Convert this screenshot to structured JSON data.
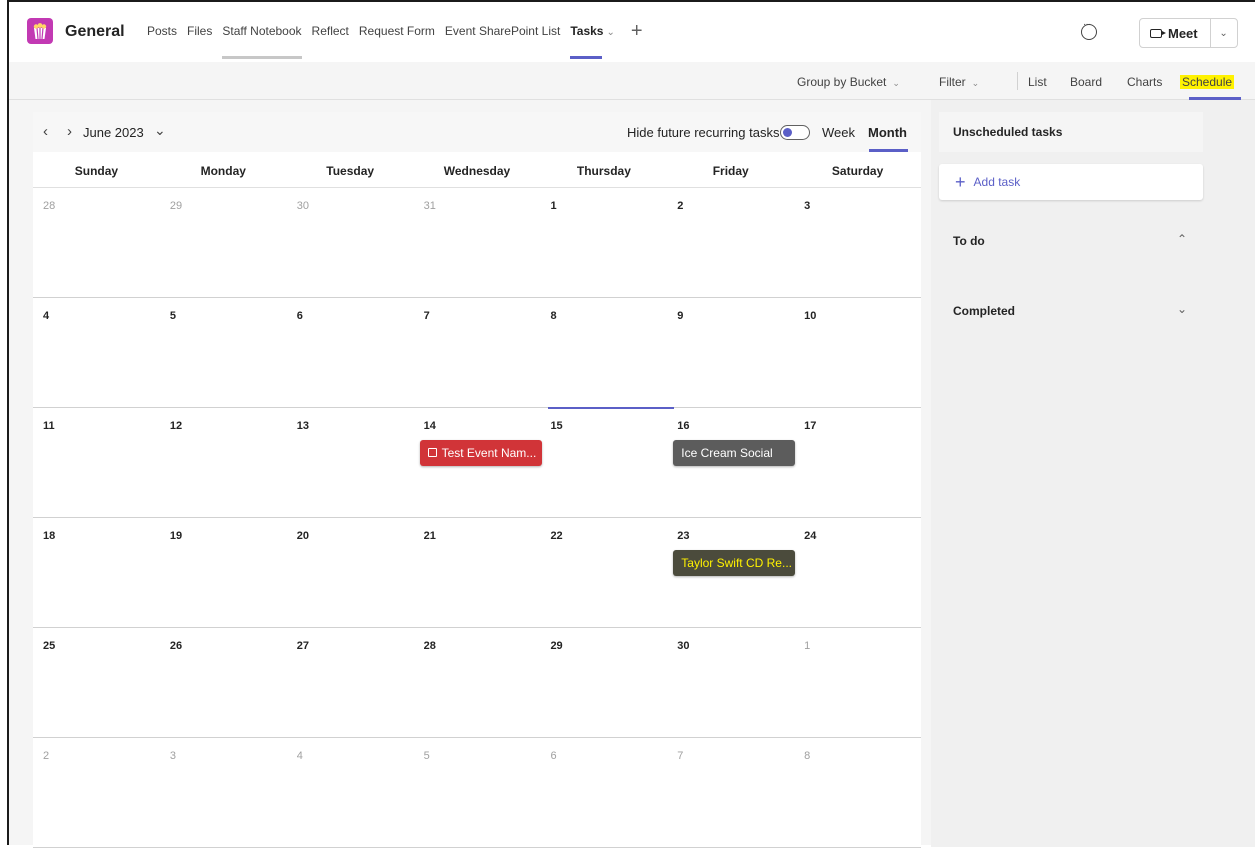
{
  "channel": {
    "name": "General"
  },
  "tabs": [
    {
      "label": "Posts"
    },
    {
      "label": "Files"
    },
    {
      "label": "Staff Notebook"
    },
    {
      "label": "Reflect"
    },
    {
      "label": "Request Form"
    },
    {
      "label": "Event SharePoint List"
    },
    {
      "label": "Tasks"
    }
  ],
  "header_actions": {
    "meet_label": "Meet"
  },
  "toolbar": {
    "group_by": "Group by Bucket",
    "filter": "Filter",
    "list": "List",
    "board": "Board",
    "charts": "Charts",
    "schedule": "Schedule"
  },
  "calendar": {
    "month_label": "June 2023",
    "hide_recurring_label": "Hide future recurring tasks",
    "hide_recurring_on": true,
    "view_week": "Week",
    "view_month": "Month",
    "active_view": "Month",
    "day_headers": [
      "Sunday",
      "Monday",
      "Tuesday",
      "Wednesday",
      "Thursday",
      "Friday",
      "Saturday"
    ],
    "weeks": [
      [
        {
          "day": "28",
          "in_month": false
        },
        {
          "day": "29",
          "in_month": false
        },
        {
          "day": "30",
          "in_month": false
        },
        {
          "day": "31",
          "in_month": false
        },
        {
          "day": "1",
          "in_month": true
        },
        {
          "day": "2",
          "in_month": true
        },
        {
          "day": "3",
          "in_month": true
        }
      ],
      [
        {
          "day": "4",
          "in_month": true
        },
        {
          "day": "5",
          "in_month": true
        },
        {
          "day": "6",
          "in_month": true
        },
        {
          "day": "7",
          "in_month": true
        },
        {
          "day": "8",
          "in_month": true
        },
        {
          "day": "9",
          "in_month": true
        },
        {
          "day": "10",
          "in_month": true
        }
      ],
      [
        {
          "day": "11",
          "in_month": true
        },
        {
          "day": "12",
          "in_month": true
        },
        {
          "day": "13",
          "in_month": true
        },
        {
          "day": "14",
          "in_month": true,
          "events": [
            {
              "title": "Test Event Nam...",
              "color": "#d13438",
              "icon": "calendar-icon"
            }
          ]
        },
        {
          "day": "15",
          "in_month": true,
          "today": true
        },
        {
          "day": "16",
          "in_month": true,
          "events": [
            {
              "title": "Ice Cream Social",
              "color": "#5c5c5c"
            }
          ]
        },
        {
          "day": "17",
          "in_month": true
        }
      ],
      [
        {
          "day": "18",
          "in_month": true
        },
        {
          "day": "19",
          "in_month": true
        },
        {
          "day": "20",
          "in_month": true
        },
        {
          "day": "21",
          "in_month": true
        },
        {
          "day": "22",
          "in_month": true
        },
        {
          "day": "23",
          "in_month": true,
          "events": [
            {
              "title": "Taylor Swift CD Re...",
              "color": "#5c5c5c",
              "highlighted": true
            }
          ]
        },
        {
          "day": "24",
          "in_month": true
        }
      ],
      [
        {
          "day": "25",
          "in_month": true
        },
        {
          "day": "26",
          "in_month": true
        },
        {
          "day": "27",
          "in_month": true
        },
        {
          "day": "28",
          "in_month": true
        },
        {
          "day": "29",
          "in_month": true
        },
        {
          "day": "30",
          "in_month": true
        },
        {
          "day": "1",
          "in_month": false
        }
      ],
      [
        {
          "day": "2",
          "in_month": false
        },
        {
          "day": "3",
          "in_month": false
        },
        {
          "day": "4",
          "in_month": false
        },
        {
          "day": "5",
          "in_month": false
        },
        {
          "day": "6",
          "in_month": false
        },
        {
          "day": "7",
          "in_month": false
        },
        {
          "day": "8",
          "in_month": false
        }
      ]
    ]
  },
  "side_panel": {
    "title": "Unscheduled tasks",
    "add_task": "Add task",
    "buckets": [
      {
        "label": "To do",
        "expanded": true
      },
      {
        "label": "Completed",
        "expanded": false
      }
    ]
  },
  "colors": {
    "accent": "#5b5fc7",
    "highlight": "#fff200",
    "event_red": "#d13438",
    "event_grey": "#5c5c5c",
    "app_icon": "#c239b3"
  }
}
